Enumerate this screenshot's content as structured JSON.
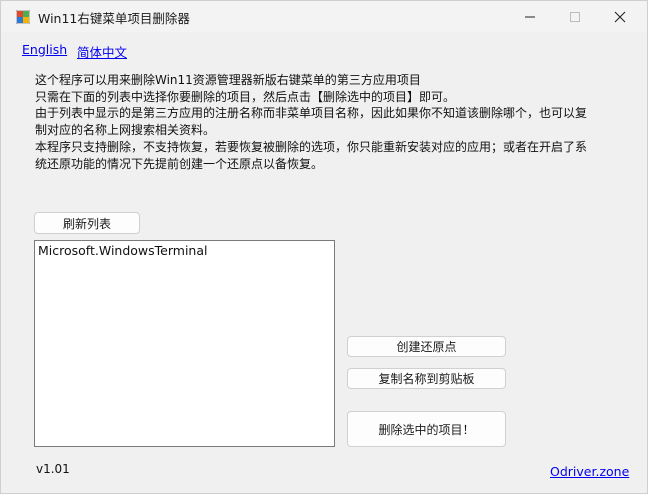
{
  "window": {
    "title": "Win11右键菜单项目删除器",
    "icon": "app-icon"
  },
  "language_links": {
    "english": "English",
    "chinese": "简体中文"
  },
  "description": {
    "lines": [
      "这个程序可以用来删除Win11资源管理器新版右键菜单的第三方应用项目",
      "只需在下面的列表中选择你要删除的项目，然后点击【删除选中的项目】即可。",
      "由于列表中显示的是第三方应用的注册名称而非菜单项目名称，因此如果你不知道该删除哪个，也可以复",
      "制对应的名称上网搜索相关资料。",
      "本程序只支持删除，不支持恢复，若要恢复被删除的选项，你只能重新安装对应的应用；或者在开启了系",
      "统还原功能的情况下先提前创建一个还原点以备恢复。"
    ]
  },
  "buttons": {
    "refresh": "刷新列表",
    "create_restore_point": "创建还原点",
    "copy_name": "复制名称到剪贴板",
    "delete_selected": "删除选中的项目！"
  },
  "list": {
    "items": [
      "Microsoft.WindowsTerminal"
    ]
  },
  "footer": {
    "version": "v1.01",
    "site": "Odriver.zone"
  },
  "colors": {
    "link": "#0000ee",
    "background": "#f0f0f0",
    "close_hover": "#c42b1c"
  }
}
